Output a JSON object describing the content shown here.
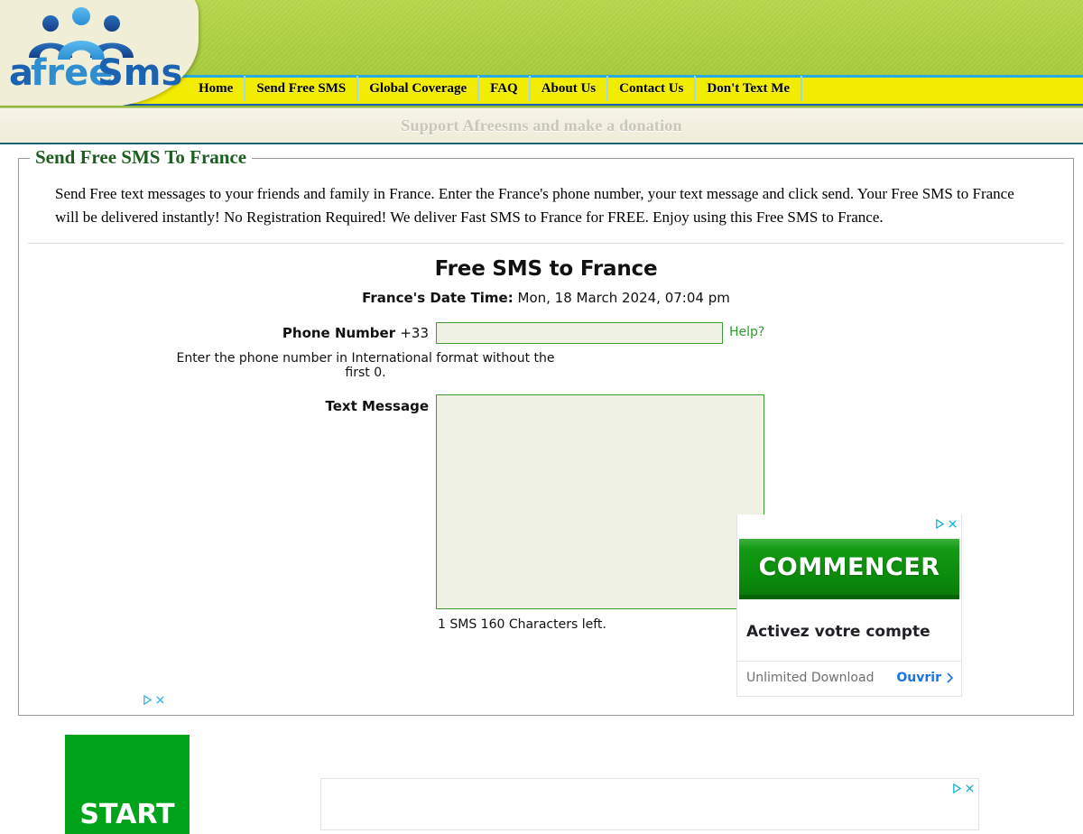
{
  "site": {
    "logo_text": "afreeSms",
    "logo_icon": "three-people-icon"
  },
  "nav": {
    "items": [
      {
        "label": "Home"
      },
      {
        "label": "Send Free SMS"
      },
      {
        "label": "Global Coverage"
      },
      {
        "label": "FAQ"
      },
      {
        "label": "About Us"
      },
      {
        "label": "Contact Us"
      },
      {
        "label": "Don't Text Me"
      }
    ]
  },
  "donation": {
    "text": "Support Afreesms and make a donation"
  },
  "panel": {
    "legend": "Send Free SMS To France",
    "intro": "Send Free text messages to your friends and family in France. Enter the France's phone number, your text message and click send. Your Free SMS to France will be delivered instantly! No Registration Required! We deliver Fast SMS to France for FREE. Enjoy using this Free SMS to France."
  },
  "form": {
    "title": "Free SMS to France",
    "datetime_label": "France's Date Time:",
    "datetime_value": " Mon, 18 March 2024, 07:04 pm",
    "phone_label": "Phone Number ",
    "phone_prefix": "+33",
    "phone_value": "",
    "phone_placeholder": "",
    "help_label": "Help?",
    "hint": "Enter the phone number in International format without the first 0.",
    "message_label": "Text Message",
    "message_value": "",
    "message_placeholder": "",
    "char_count": "1 SMS 160 Characters left."
  },
  "ads": {
    "right": {
      "button_label": "COMMENCER",
      "headline": "Activez votre compte",
      "footer_text": "Unlimited Download",
      "cta_label": "Ouvrir",
      "cta_icon": "chevron-right-icon",
      "adchoices_icon": "adchoices-icon",
      "close_icon": "close-icon"
    },
    "left": {
      "banner_label": "START",
      "adchoices_icon": "adchoices-icon",
      "close_icon": "close-icon"
    },
    "bottom": {
      "adchoices_icon": "adchoices-icon",
      "close_icon": "close-icon"
    }
  },
  "colors": {
    "header_green": "#a8cc3e",
    "nav_yellow": "#f2ec00",
    "nav_border_blue": "#1b63b0",
    "legend_green": "#1b5e20",
    "input_border_green": "#3f9c35",
    "input_fill": "#eff1e4",
    "link_green": "#2b9b2b",
    "ad_green": "#0b8a0b",
    "ad_blue": "#1a73e8"
  }
}
